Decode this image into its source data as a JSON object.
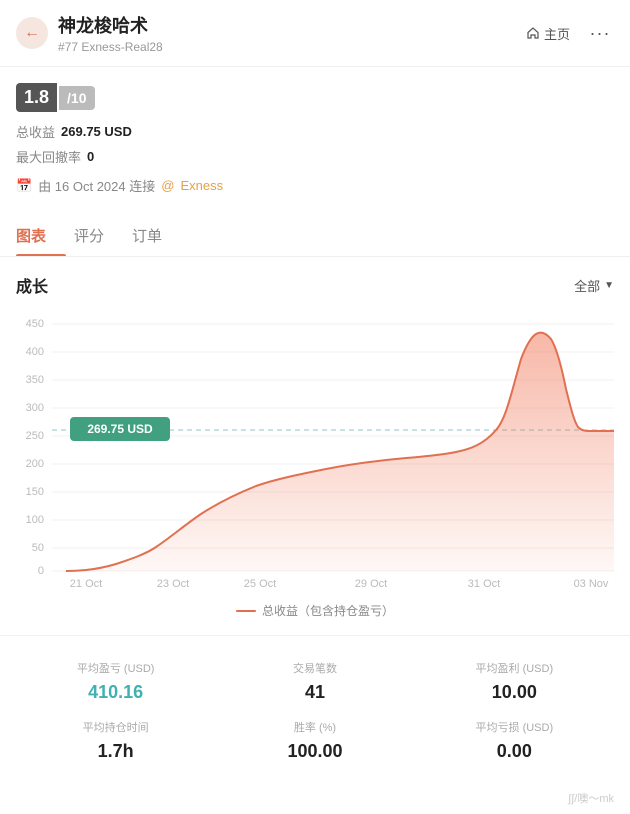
{
  "header": {
    "back_label": "←",
    "title": "神龙梭哈术",
    "subtitle": "#77  Exness-Real28",
    "home_label": "主页",
    "more_label": "···"
  },
  "score": {
    "value": "1.8",
    "max": "/10"
  },
  "stats": {
    "total_profit_label": "总收益",
    "total_profit_value": "269.75 USD",
    "max_drawdown_label": "最大回撤率",
    "max_drawdown_value": "0",
    "connected_label": "由 16 Oct 2024 连接",
    "at_label": "@",
    "broker": "Exness"
  },
  "tabs": [
    {
      "label": "图表",
      "active": true
    },
    {
      "label": "评分",
      "active": false
    },
    {
      "label": "订单",
      "active": false
    }
  ],
  "chart": {
    "title": "成长",
    "filter": "全部",
    "tooltip_value": "269.75 USD",
    "y_labels": [
      "450",
      "400",
      "350",
      "300",
      "250",
      "200",
      "150",
      "100",
      "50",
      "0"
    ],
    "x_labels": [
      "21 Oct",
      "23 Oct",
      "25 Oct",
      "29 Oct",
      "31 Oct",
      "03 Nov"
    ],
    "legend_text": "总收益（包含持仓盈亏）"
  },
  "metrics": [
    {
      "label": "平均盈亏 (USD)",
      "value": "410.16",
      "highlight": true
    },
    {
      "label": "交易笔数",
      "value": "41",
      "highlight": false
    },
    {
      "label": "平均盈利 (USD)",
      "value": "10.00",
      "highlight": false
    },
    {
      "label": "平均持仓时间",
      "value": "1.7h",
      "highlight": false
    },
    {
      "label": "胜率 (%)",
      "value": "100.00",
      "highlight": false
    },
    {
      "label": "平均亏损 (USD)",
      "value": "0.00",
      "highlight": false
    }
  ],
  "watermark": "∫∫/噢～mk"
}
